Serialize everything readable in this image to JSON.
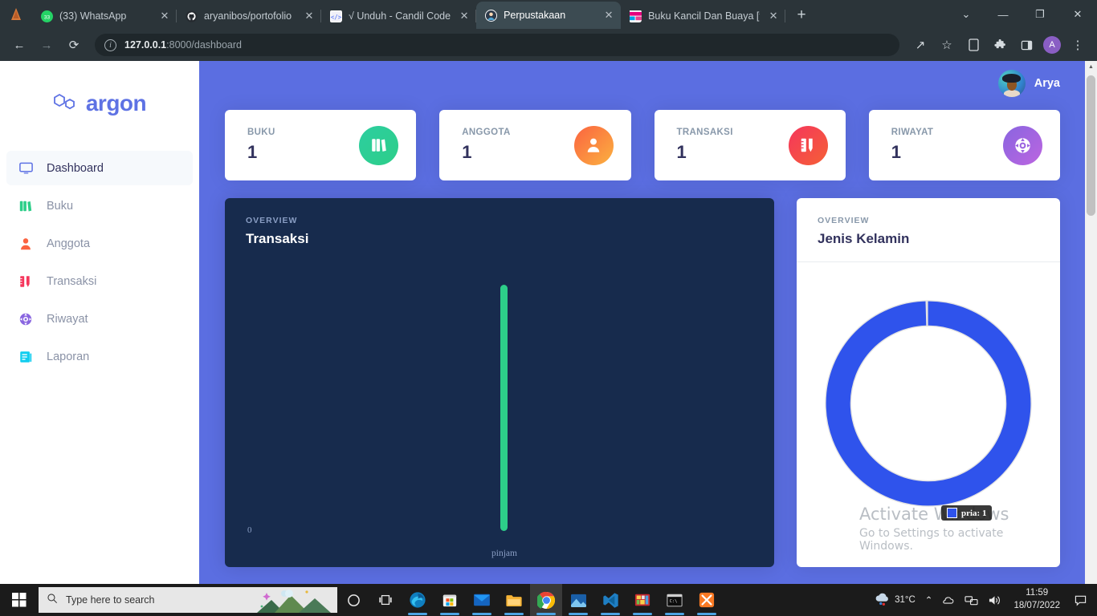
{
  "browser": {
    "tabs": [
      {
        "title": "(33) WhatsApp",
        "favicon": "whatsapp-icon",
        "active": false
      },
      {
        "title": "aryanibos/portofolio",
        "favicon": "github-icon",
        "active": false
      },
      {
        "title": "√ Unduh - Candil Code",
        "favicon": "code-icon",
        "active": false
      },
      {
        "title": "Perpustakaan",
        "favicon": "avatar-icon",
        "active": true
      },
      {
        "title": "Buku Kancil Dan Buaya [full",
        "favicon": "video-icon",
        "active": false
      }
    ],
    "newtab_label": "+",
    "window_controls": {
      "collapse": "⌄",
      "minimize": "—",
      "maximize": "❐",
      "close": "✕"
    },
    "toolbar": {
      "back": "←",
      "forward": "→",
      "reload": "⟳",
      "url": "127.0.0.1:8000/dashboard",
      "url_host": "127.0.0.1",
      "url_path": ":8000/dashboard",
      "share": "↗",
      "bookmark": "☆",
      "profile_initial": "A",
      "menu": "⋮"
    }
  },
  "sidebar": {
    "logo_text": "argon",
    "items": [
      {
        "label": "Dashboard",
        "icon": "monitor-icon",
        "active": true
      },
      {
        "label": "Buku",
        "icon": "books-icon",
        "active": false
      },
      {
        "label": "Anggota",
        "icon": "person-icon",
        "active": false
      },
      {
        "label": "Transaksi",
        "icon": "ruler-pen-icon",
        "active": false
      },
      {
        "label": "Riwayat",
        "icon": "lifebuoy-icon",
        "active": false
      },
      {
        "label": "Laporan",
        "icon": "document-icon",
        "active": false
      }
    ]
  },
  "topbar": {
    "user_name": "Arya"
  },
  "stats": [
    {
      "label": "BUKU",
      "value": "1",
      "icon": "books-icon",
      "color": "#2dce89"
    },
    {
      "label": "ANGGOTA",
      "value": "1",
      "icon": "person-icon",
      "color": "#fb6340"
    },
    {
      "label": "TRANSAKSI",
      "value": "1",
      "icon": "ruler-pen-icon",
      "color": "#f5365c"
    },
    {
      "label": "RIWAYAT",
      "value": "1",
      "icon": "lifebuoy-icon",
      "color": "#8965e0"
    }
  ],
  "cards": {
    "bar": {
      "overview_label": "OVERVIEW",
      "title": "Transaksi"
    },
    "donut": {
      "overview_label": "OVERVIEW",
      "title": "Jenis Kelamin"
    }
  },
  "chart_data": [
    {
      "type": "bar",
      "title": "Transaksi",
      "subtitle": "OVERVIEW",
      "categories": [
        "pinjam"
      ],
      "values": [
        1
      ],
      "xlabel": "",
      "ylabel": "",
      "ytick_labels": [
        "0"
      ],
      "ylim": [
        0,
        1
      ],
      "grid": false,
      "legend": "none",
      "bar_color": "#2dce89",
      "background": "#172b4d"
    },
    {
      "type": "pie",
      "variant": "doughnut",
      "title": "Jenis Kelamin",
      "subtitle": "OVERVIEW",
      "labels": [
        "pria"
      ],
      "values": [
        1
      ],
      "colors": [
        "#2f53ec"
      ],
      "legend": "none",
      "tooltip": {
        "label": "pria",
        "value": "1",
        "text": "pria: 1"
      },
      "background": "#ffffff"
    }
  ],
  "watermark": {
    "line1": "Activate Windows",
    "line2": "Go to Settings to activate Windows."
  },
  "taskbar": {
    "start_icon": "windows-start-icon",
    "search_placeholder": "Type here to search",
    "icons": [
      {
        "name": "cortana-icon"
      },
      {
        "name": "task-view-icon"
      },
      {
        "name": "edge-icon"
      },
      {
        "name": "microsoft-store-icon"
      },
      {
        "name": "mail-icon"
      },
      {
        "name": "file-explorer-icon"
      },
      {
        "name": "chrome-icon"
      },
      {
        "name": "photos-icon"
      },
      {
        "name": "vscode-icon"
      },
      {
        "name": "winrar-icon"
      },
      {
        "name": "terminal-icon"
      },
      {
        "name": "xampp-icon"
      }
    ],
    "tray": {
      "weather_temp": "31°C",
      "chevron": "⌃",
      "time": "11:59",
      "date": "18/07/2022"
    }
  },
  "colors": {
    "accent": "#5e72e4",
    "page_bg": "#5b6ee1",
    "dark_card": "#172b4d",
    "bar_green": "#2dce89",
    "donut_blue": "#2f53ec"
  }
}
